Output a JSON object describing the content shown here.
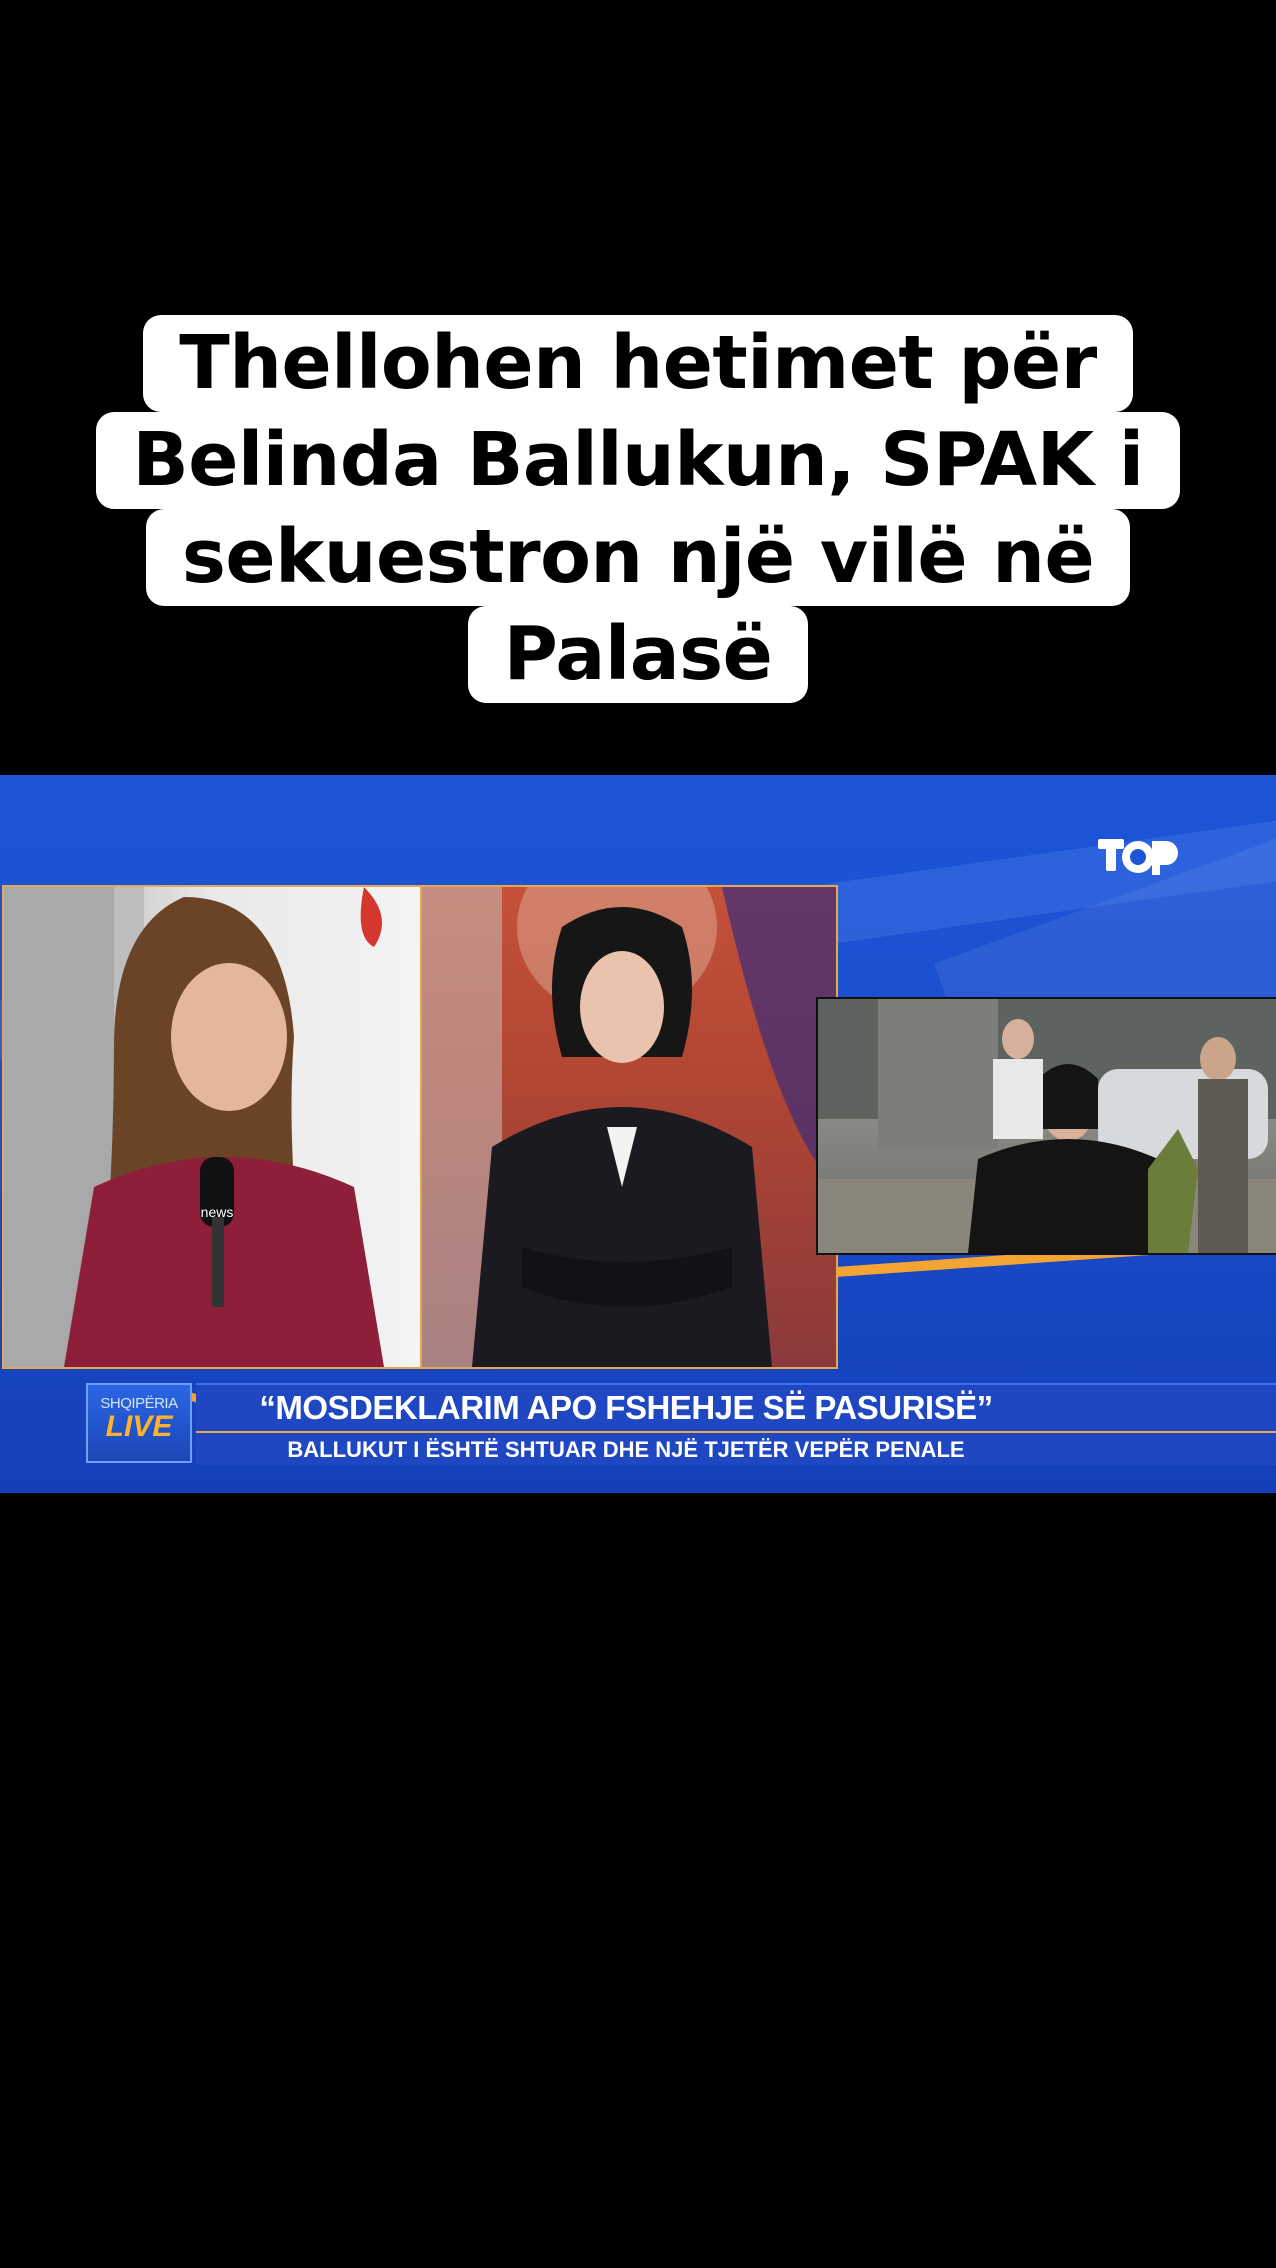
{
  "caption": {
    "lines": [
      "Thellohen hetimet për",
      "Belinda Ballukun, SPAK i",
      "sekuestron një vilë në",
      "Palasë"
    ]
  },
  "video": {
    "channel_logo_icon": "top-channel-logo-icon",
    "microphone_brand": "news",
    "lower_third": {
      "show_logo_top": "SHQIPËRIA",
      "show_logo_bottom": "LIVE",
      "headline": "“MOSDEKLARIM APO FSHEHJE SË PASURISË”",
      "subheadline": "BALLUKUT I ËSHTË SHTUAR DHE NJË TJETËR VEPËR PENALE"
    }
  },
  "colors": {
    "background": "#000000",
    "studio_blue": "#1d55d8",
    "accent_orange": "#f3a432",
    "caption_bg": "#ffffff"
  }
}
